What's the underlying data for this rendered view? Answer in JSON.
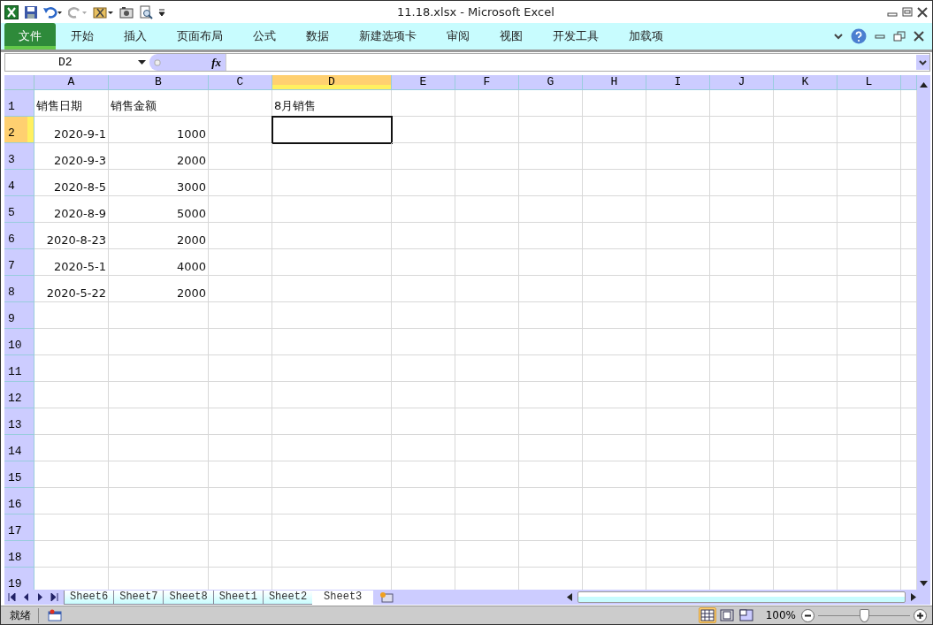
{
  "window": {
    "title": "11.18.xlsx  -  Microsoft Excel"
  },
  "ribbon_tabs": [
    {
      "label": "文件",
      "selected": true,
      "kind": "file"
    },
    {
      "label": "开始",
      "selected": false,
      "kind": "tab"
    },
    {
      "label": "插入",
      "selected": false,
      "kind": "tab"
    },
    {
      "label": "页面布局",
      "selected": false,
      "kind": "tab"
    },
    {
      "label": "公式",
      "selected": false,
      "kind": "tab"
    },
    {
      "label": "数据",
      "selected": false,
      "kind": "tab"
    },
    {
      "label": "新建选项卡",
      "selected": false,
      "kind": "tab"
    },
    {
      "label": "审阅",
      "selected": false,
      "kind": "tab"
    },
    {
      "label": "视图",
      "selected": false,
      "kind": "tab"
    },
    {
      "label": "开发工具",
      "selected": false,
      "kind": "tab"
    },
    {
      "label": "加载项",
      "selected": false,
      "kind": "tab"
    }
  ],
  "formula_bar": {
    "name_box": "D2",
    "fx_label": "fx"
  },
  "columns": [
    {
      "label": "A",
      "selected": false
    },
    {
      "label": "B",
      "selected": false
    },
    {
      "label": "C",
      "selected": false
    },
    {
      "label": "D",
      "selected": true
    },
    {
      "label": "E",
      "selected": false
    },
    {
      "label": "F",
      "selected": false
    },
    {
      "label": "G",
      "selected": false
    },
    {
      "label": "H",
      "selected": false
    },
    {
      "label": "I",
      "selected": false
    },
    {
      "label": "J",
      "selected": false
    },
    {
      "label": "K",
      "selected": false
    },
    {
      "label": "L",
      "selected": false
    }
  ],
  "rows": [
    {
      "number": "1",
      "selected": false,
      "cells": [
        {
          "text": "销售日期",
          "kind": "text"
        },
        {
          "text": "销售金额",
          "kind": "text"
        },
        null,
        {
          "text": "8月销售",
          "kind": "text"
        }
      ]
    },
    {
      "number": "2",
      "selected": true,
      "cells": [
        {
          "text": "2020-9-1",
          "kind": "number"
        },
        {
          "text": "1000",
          "kind": "number"
        }
      ]
    },
    {
      "number": "3",
      "selected": false,
      "cells": [
        {
          "text": "2020-9-3",
          "kind": "number"
        },
        {
          "text": "2000",
          "kind": "number"
        }
      ]
    },
    {
      "number": "4",
      "selected": false,
      "cells": [
        {
          "text": "2020-8-5",
          "kind": "number"
        },
        {
          "text": "3000",
          "kind": "number"
        }
      ]
    },
    {
      "number": "5",
      "selected": false,
      "cells": [
        {
          "text": "2020-8-9",
          "kind": "number"
        },
        {
          "text": "5000",
          "kind": "number"
        }
      ]
    },
    {
      "number": "6",
      "selected": false,
      "cells": [
        {
          "text": "2020-8-23",
          "kind": "number"
        },
        {
          "text": "2000",
          "kind": "number"
        }
      ]
    },
    {
      "number": "7",
      "selected": false,
      "cells": [
        {
          "text": "2020-5-1",
          "kind": "number"
        },
        {
          "text": "4000",
          "kind": "number"
        }
      ]
    },
    {
      "number": "8",
      "selected": false,
      "cells": [
        {
          "text": "2020-5-22",
          "kind": "number"
        },
        {
          "text": "2000",
          "kind": "number"
        }
      ]
    },
    {
      "number": "9",
      "selected": false,
      "cells": []
    },
    {
      "number": "10",
      "selected": false,
      "cells": []
    },
    {
      "number": "11",
      "selected": false,
      "cells": []
    },
    {
      "number": "12",
      "selected": false,
      "cells": []
    },
    {
      "number": "13",
      "selected": false,
      "cells": []
    },
    {
      "number": "14",
      "selected": false,
      "cells": []
    },
    {
      "number": "15",
      "selected": false,
      "cells": []
    },
    {
      "number": "16",
      "selected": false,
      "cells": []
    },
    {
      "number": "17",
      "selected": false,
      "cells": []
    },
    {
      "number": "18",
      "selected": false,
      "cells": []
    },
    {
      "number": "19",
      "selected": false,
      "cells": []
    }
  ],
  "sheet_tabs": [
    {
      "label": "Sheet6",
      "selected": false
    },
    {
      "label": "Sheet7",
      "selected": false
    },
    {
      "label": "Sheet8",
      "selected": false
    },
    {
      "label": "Sheet1",
      "selected": false
    },
    {
      "label": "Sheet2",
      "selected": false
    },
    {
      "label": "Sheet3",
      "selected": true
    }
  ],
  "status_bar": {
    "status": "就绪",
    "views": [
      {
        "kind": "normal",
        "selected": true
      },
      {
        "kind": "layout",
        "selected": false
      },
      {
        "kind": "pagebreak",
        "selected": false
      }
    ],
    "zoom": "100%",
    "zoom_slider": {
      "level": 0.5
    }
  }
}
